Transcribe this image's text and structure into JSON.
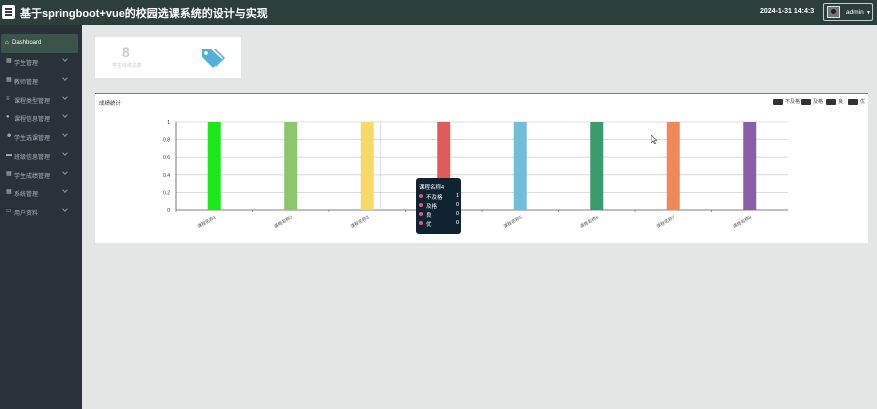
{
  "header": {
    "title": "基于springboot+vue的校园选课系统的设计与实现",
    "datetime": "2024-1-31 14:4:3",
    "user": "admin"
  },
  "sidebar": {
    "items": [
      {
        "label": "Dashboard",
        "icon": "home-icon",
        "active": true
      },
      {
        "label": "学生管理",
        "icon": "grid-icon"
      },
      {
        "label": "教师管理",
        "icon": "grid-icon"
      },
      {
        "label": "课程类型管理",
        "icon": "list-icon"
      },
      {
        "label": "课程信息管理",
        "icon": "user-icon"
      },
      {
        "label": "学生选课管理",
        "icon": "people-icon"
      },
      {
        "label": "班级信息管理",
        "icon": "folder-icon"
      },
      {
        "label": "学生成绩管理",
        "icon": "grid-icon"
      },
      {
        "label": "系统管理",
        "icon": "grid-icon"
      },
      {
        "label": "用户资料",
        "icon": "id-card-icon"
      }
    ]
  },
  "stat": {
    "value": "8",
    "label": "学生成绩总数"
  },
  "chart_panel": {
    "title": "成绩统计",
    "legend": [
      "不及格",
      "及格",
      "良",
      "优"
    ]
  },
  "chart_data": {
    "type": "bar",
    "title": "成绩统计",
    "categories": [
      "课程名称1",
      "课程名称2",
      "课程名称3",
      "课程名称4",
      "课程名称5",
      "课程名称6",
      "课程名称7",
      "课程名称8"
    ],
    "values": [
      1,
      1,
      1,
      1,
      1,
      1,
      1,
      1
    ],
    "bar_colors": [
      "#1fe51b",
      "#8cc56c",
      "#f9d86a",
      "#e05c5c",
      "#74bcd7",
      "#3c9a6c",
      "#f0885a",
      "#8b5ea8"
    ],
    "series": [
      {
        "name": "不及格",
        "values": [
          1,
          1,
          1,
          1,
          1,
          1,
          1,
          1
        ]
      },
      {
        "name": "及格",
        "values": [
          0,
          0,
          0,
          0,
          0,
          0,
          0,
          0
        ]
      },
      {
        "name": "良",
        "values": [
          0,
          0,
          0,
          0,
          0,
          0,
          0,
          0
        ]
      },
      {
        "name": "优",
        "values": [
          0,
          0,
          0,
          0,
          0,
          0,
          0,
          0
        ]
      }
    ],
    "y_ticks": [
      "0",
      "0.2",
      "0.4",
      "0.6",
      "0.8",
      "1"
    ],
    "ylim": [
      0,
      1
    ],
    "grid": true,
    "legend_position": "top-right"
  },
  "tooltip": {
    "title": "课程名称4",
    "rows": [
      {
        "name": "不及格",
        "value": "1"
      },
      {
        "name": "及格",
        "value": "0"
      },
      {
        "name": "良",
        "value": "0"
      },
      {
        "name": "优",
        "value": "0"
      }
    ]
  },
  "colors": {
    "header_bg": "#2d3f3a",
    "sidebar_bg": "#2a3138",
    "active_item": "#3a5449",
    "tag_icon": "#55b0d8"
  }
}
